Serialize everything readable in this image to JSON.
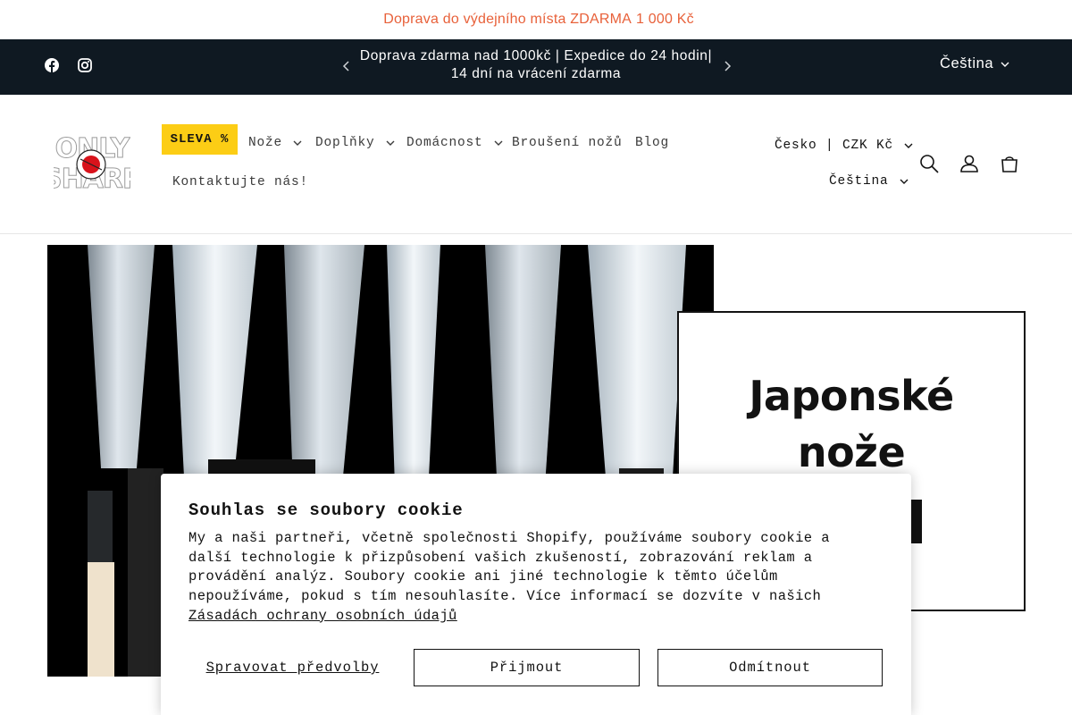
{
  "promo": {
    "icon": "info-glyph",
    "icon_char": "",
    "text": "Doprava do výdejního místa ZDARMA",
    "price": "1 000 Kč",
    "color": "#e8613a"
  },
  "announcement": {
    "background": "#0f1922",
    "social": [
      {
        "name": "facebook-icon"
      },
      {
        "name": "instagram-icon"
      }
    ],
    "text": "Doprava zdarma nad 1000kč | Expedice do 24 hodin| 14 dní na vrácení zdarma",
    "language": "Čeština"
  },
  "header": {
    "logo_text": [
      "ONLY",
      "SHARP"
    ],
    "sale_label": "SLEVA %",
    "sale_color": "#fccd15",
    "nav": [
      {
        "label": "Nože",
        "has_dropdown": true
      },
      {
        "label": "Doplňky",
        "has_dropdown": true
      },
      {
        "label": "Domácnost",
        "has_dropdown": true
      },
      {
        "label": "Broušení nožů",
        "has_dropdown": false
      },
      {
        "label": "Blog",
        "has_dropdown": false
      },
      {
        "label": "Kontaktujte nás!",
        "has_dropdown": false
      }
    ],
    "country": "Česko | CZK Kč",
    "language": "Čeština",
    "icons": [
      "search-icon",
      "account-icon",
      "cart-icon"
    ]
  },
  "hero": {
    "title_line1": "Japonské",
    "title_line2": "nože"
  },
  "cookie": {
    "title": "Souhlas se soubory cookie",
    "body": "My a naši partneři, včetně společnosti Shopify, používáme soubory cookie a další technologie k přizpůsobení vašich zkušeností, zobrazování reklam a provádění analýz. Soubory cookie ani jiné technologie k těmto účelům nepoužíváme, pokud s tím nesouhlasíte. Více informací se dozvíte v našich",
    "link": "Zásadách ochrany osobních údajů",
    "manage_label": "Spravovat předvolby",
    "accept_label": "Přijmout",
    "decline_label": "Odmítnout"
  }
}
